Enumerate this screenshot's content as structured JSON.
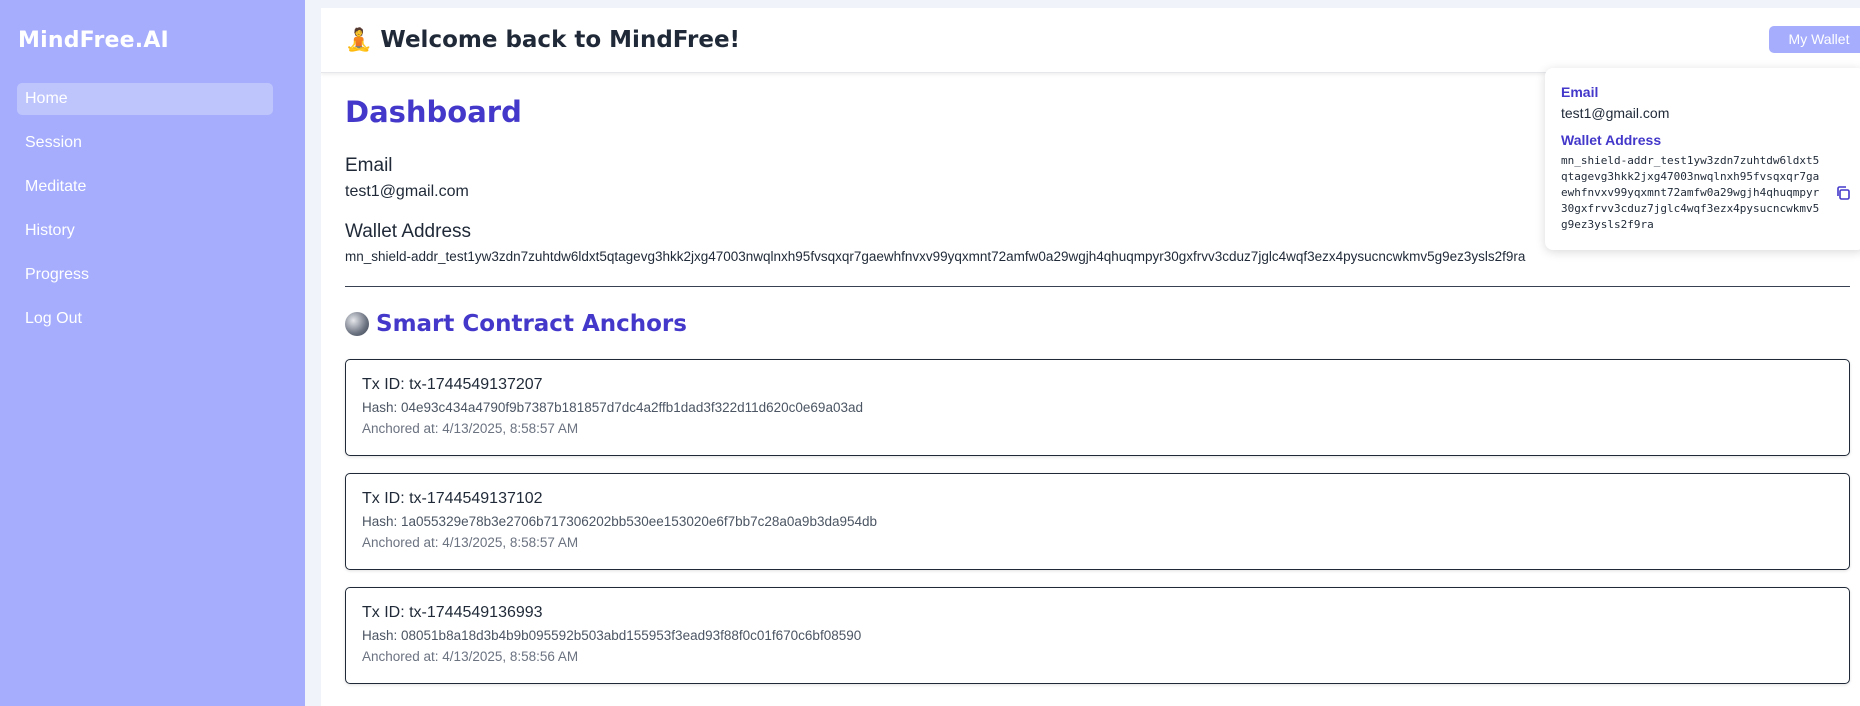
{
  "sidebar": {
    "brand": "MindFree.AI",
    "items": [
      {
        "label": "Home"
      },
      {
        "label": "Session"
      },
      {
        "label": "Meditate"
      },
      {
        "label": "History"
      },
      {
        "label": "Progress"
      },
      {
        "label": "Log Out"
      }
    ],
    "active_item": "Home"
  },
  "header": {
    "icon": "🧘",
    "title": "Welcome back to MindFree!",
    "wallet_button": "My Wallet"
  },
  "dashboard": {
    "title": "Dashboard",
    "email_label": "Email",
    "email_value": "test1@gmail.com",
    "wallet_label": "Wallet Address",
    "wallet_value": "mn_shield-addr_test1yw3zdn7zuhtdw6ldxt5qtagevg3hkk2jxg47003nwqlnxh95fvsqxqr7gaewhfnvxv99yqxmnt72amfw0a29wgjh4qhuqmpyr30gxfrvv3cduz7jglc4wqf3ezx4pysucncwkmv5g9ez3ysls2f9ra"
  },
  "anchors": {
    "icon": "globe-icon",
    "title": "Smart Contract Anchors",
    "items": [
      {
        "tx_id": "Tx ID: tx-1744549137207",
        "hash": "Hash: 04e93c434a4790f9b7387b181857d7dc4a2ffb1dad3f322d11d620c0e69a03ad",
        "anchored": "Anchored at: 4/13/2025, 8:58:57 AM"
      },
      {
        "tx_id": "Tx ID: tx-1744549137102",
        "hash": "Hash: 1a055329e78b3e2706b717306202bb530ee153020e6f7bb7c28a0a9b3da954db",
        "anchored": "Anchored at: 4/13/2025, 8:58:57 AM"
      },
      {
        "tx_id": "Tx ID: tx-1744549136993",
        "hash": "Hash: 08051b8a18d3b4b9b095592b503abd155953f3ead93f88f0c01f670c6bf08590",
        "anchored": "Anchored at: 4/13/2025, 8:58:56 AM"
      }
    ]
  },
  "wallet_popup": {
    "email_label": "Email",
    "email_value": "test1@gmail.com",
    "address_label": "Wallet Address",
    "address_value": "mn_shield-addr_test1yw3zdn7zuhtdw6ldxt5qtagevg3hkk2jxg47003nwqlnxh95fvsqxqr7gaewhfnvxv99yqxmnt72amfw0a29wgjh4qhuqmpyr30gxfrvv3cduz7jglc4wqf3ezx4pysucncwkmv5g9ez3ysls2f9ra",
    "copy_icon": "copy-icon"
  },
  "colors": {
    "sidebar_bg": "#a5adfc",
    "accent": "#4338ca",
    "active_nav": "#bec5fd"
  }
}
